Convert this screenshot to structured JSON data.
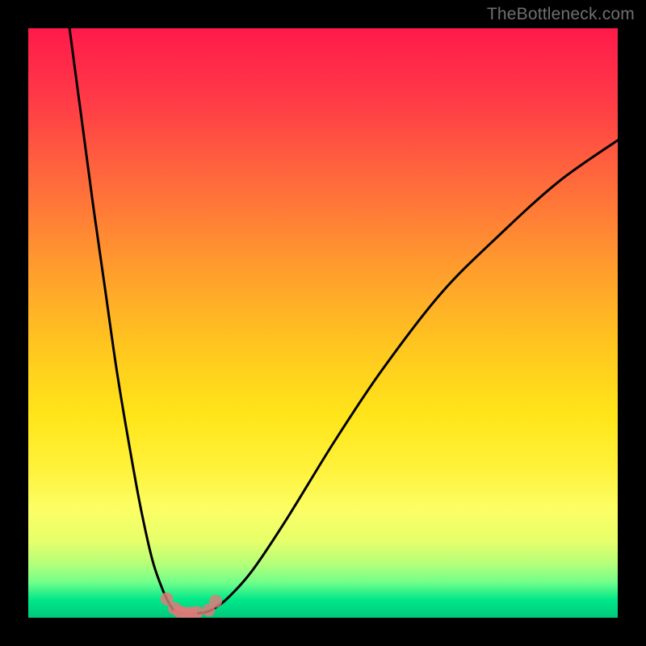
{
  "watermark": "TheBottleneck.com",
  "chart_data": {
    "type": "line",
    "title": "",
    "xlabel": "",
    "ylabel": "",
    "xlim": [
      0,
      100
    ],
    "ylim": [
      0,
      100
    ],
    "grid": false,
    "legend": null,
    "series": [
      {
        "name": "left-branch",
        "x": [
          7,
          9,
          11,
          13,
          15,
          17,
          19,
          21,
          22.5,
          23.5,
          24.3,
          24.8
        ],
        "y": [
          100,
          85,
          70,
          56,
          42,
          30,
          19,
          10,
          5.5,
          3.2,
          1.8,
          1.2
        ]
      },
      {
        "name": "trough",
        "x": [
          24.8,
          25.8,
          26.8,
          27.8,
          29.0,
          30.3,
          31.6
        ],
        "y": [
          1.2,
          0.8,
          0.7,
          0.7,
          0.8,
          1.0,
          1.6
        ]
      },
      {
        "name": "right-branch",
        "x": [
          31.6,
          34,
          38,
          44,
          52,
          60,
          70,
          80,
          90,
          100
        ],
        "y": [
          1.6,
          3.5,
          8,
          17,
          30,
          42,
          55,
          65,
          74,
          81
        ]
      }
    ],
    "highlight_points": {
      "name": "trough-cluster",
      "x": [
        23.5,
        24.8,
        25.7,
        26.6,
        27.6,
        28.6,
        30.6,
        31.8
      ],
      "y": [
        3.2,
        1.6,
        1.0,
        0.8,
        0.8,
        0.9,
        1.3,
        2.8
      ]
    }
  }
}
